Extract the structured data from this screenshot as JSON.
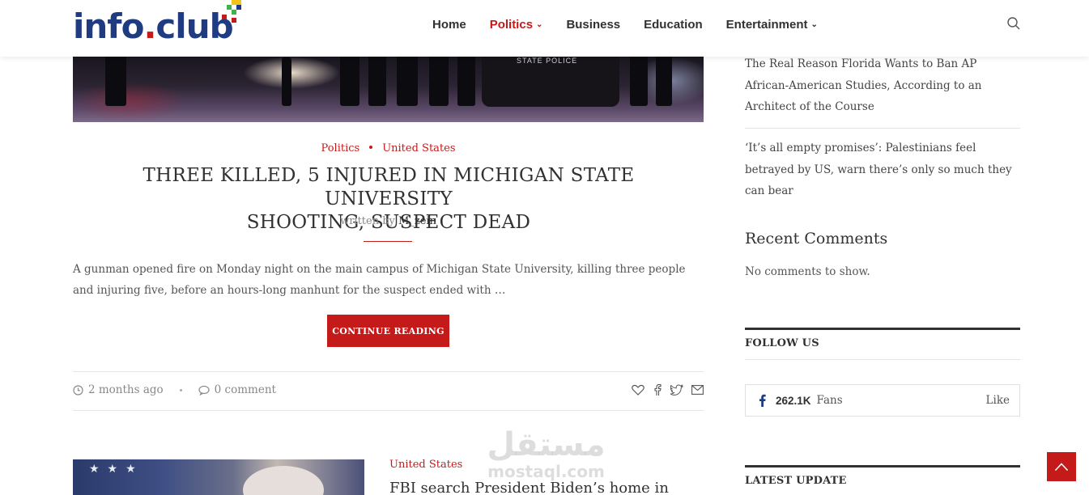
{
  "header": {
    "logo_main": "info",
    "logo_dot": ".",
    "logo_end": "club",
    "nav": [
      {
        "label": "Home",
        "active": false,
        "dropdown": false
      },
      {
        "label": "Politics",
        "active": true,
        "dropdown": true
      },
      {
        "label": "Business",
        "active": false,
        "dropdown": false
      },
      {
        "label": "Education",
        "active": false,
        "dropdown": false
      },
      {
        "label": "Entertainment",
        "active": false,
        "dropdown": true
      }
    ],
    "search_icon": "search-icon"
  },
  "hero": {
    "car_text": "STATE POLICE"
  },
  "article": {
    "categories": [
      "Politics",
      "United States"
    ],
    "title_line1": "THREE KILLED, 5 INJURED IN MICHIGAN STATE UNIVERSITY",
    "title_line2": "SHOOTING, SUSPECT DEAD",
    "byline_prefix": "written by",
    "author": "M_zein",
    "excerpt": "A gunman opened fire on Monday night on the main campus of Michigan State University, killing three people and injuring five, before an hours-long manhunt for the suspect ended with …",
    "continue_label": "CONTINUE READING",
    "time_ago": "2 months ago",
    "comments": "0 comment",
    "share_icons": [
      "heart-icon",
      "facebook-icon",
      "twitter-icon",
      "mail-icon"
    ]
  },
  "article2": {
    "category": "United States",
    "title": "FBI search President Biden’s home in"
  },
  "watermark": {
    "arabic": "مستقل",
    "latin": "mostaql.com"
  },
  "sidebar": {
    "related_links": [
      "The Real Reason Florida Wants to Ban AP African-American Studies, According to an Architect of the Course",
      "‘It’s all empty promises’: Palestinians feel betrayed by US, warn there’s only so much they can bear"
    ],
    "recent_comments_heading": "Recent Comments",
    "no_comments": "No comments to show.",
    "follow_us": "FOLLOW US",
    "fb_count": "262.1K",
    "fb_fans": "Fans",
    "fb_like": "Like",
    "latest_update": "LATEST UPDATE"
  },
  "colors": {
    "accent": "#c41a1a",
    "logo_blue": "#1f3b82",
    "text": "#313131"
  }
}
